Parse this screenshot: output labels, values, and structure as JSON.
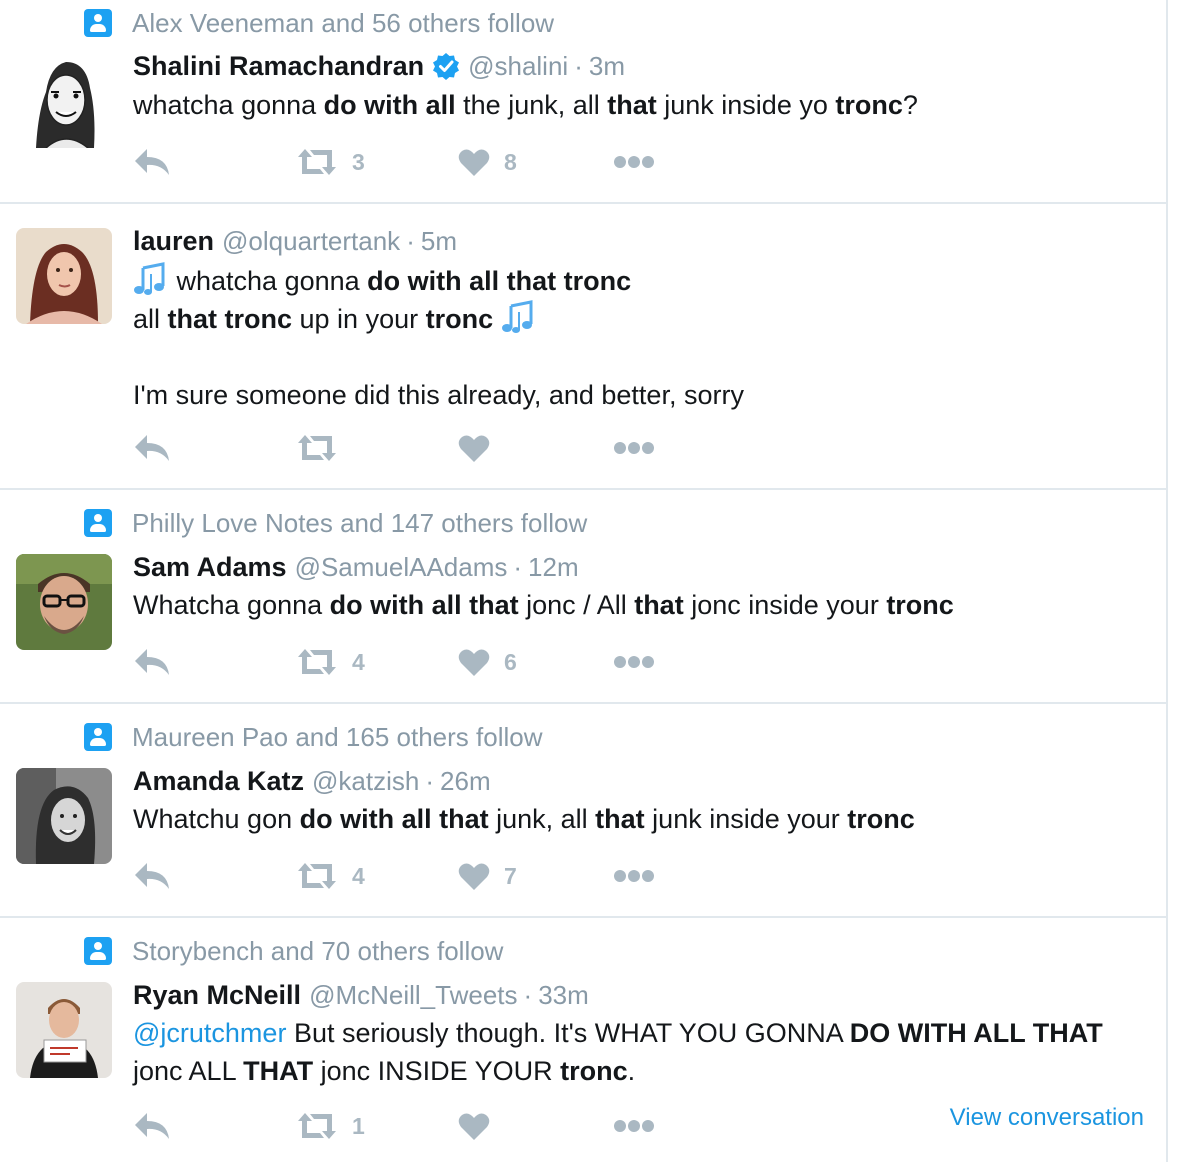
{
  "colors": {
    "accent": "#1da1f2",
    "link": "#1b95e0",
    "muted": "#8899a6",
    "action": "#aab8c2",
    "border": "#e1e8ed"
  },
  "tweets": [
    {
      "context": "Alex Veeneman and 56 others follow",
      "avatar_icon": "sketch-portrait",
      "name": "Shalini Ramachandran",
      "verified": true,
      "handle": "@shalini",
      "sep": "·",
      "time": "3m",
      "lines": [
        [
          "whatcha gonna ",
          {
            "b": "do with all"
          },
          " the junk, all ",
          {
            "b": "that"
          },
          " junk inside yo ",
          {
            "b": "tronc"
          },
          "?"
        ]
      ],
      "retweets": "3",
      "likes": "8"
    },
    {
      "context": "",
      "avatar_icon": "woman-photo",
      "name": "lauren",
      "verified": false,
      "handle": "@olquartertank",
      "sep": "·",
      "time": "5m",
      "lines": [
        [
          {
            "emoji": "music-notes"
          },
          " whatcha gonna ",
          {
            "b": "do with all that tronc"
          }
        ],
        [
          "all ",
          {
            "b": "that tronc"
          },
          " up in your ",
          {
            "b": "tronc"
          },
          " ",
          {
            "emoji": "music-notes"
          }
        ],
        [
          ""
        ],
        [
          "I'm sure someone did this already, and better, sorry"
        ]
      ],
      "retweets": "",
      "likes": ""
    },
    {
      "context": "Philly Love Notes and 147 others follow",
      "avatar_icon": "man-glasses-photo",
      "name": "Sam Adams",
      "verified": false,
      "handle": "@SamuelAAdams",
      "sep": "·",
      "time": "12m",
      "lines": [
        [
          "Whatcha gonna ",
          {
            "b": "do with all that"
          },
          " jonc / All ",
          {
            "b": "that"
          },
          " jonc inside your ",
          {
            "b": "tronc"
          }
        ]
      ],
      "retweets": "4",
      "likes": "6"
    },
    {
      "context": "Maureen Pao and 165 others follow",
      "avatar_icon": "woman-bw-photo",
      "name": "Amanda Katz",
      "verified": false,
      "handle": "@katzish",
      "sep": "·",
      "time": "26m",
      "lines": [
        [
          "Whatchu gon ",
          {
            "b": "do with all that"
          },
          " junk, all ",
          {
            "b": "that"
          },
          " junk inside your ",
          {
            "b": "tronc"
          }
        ]
      ],
      "retweets": "4",
      "likes": "7"
    },
    {
      "context": "Storybench and 70 others follow",
      "avatar_icon": "man-sign-photo",
      "name": "Ryan McNeill",
      "verified": false,
      "handle": "@McNeill_Tweets",
      "sep": "·",
      "time": "33m",
      "lines": [
        [
          {
            "link": "@jcrutchmer"
          },
          " But seriously though. It's WHAT YOU GONNA ",
          {
            "b": "DO WITH ALL THAT"
          }
        ],
        [
          "jonc ALL ",
          {
            "b": "THAT"
          },
          " jonc INSIDE YOUR ",
          {
            "b": "tronc"
          },
          "."
        ]
      ],
      "retweets": "1",
      "likes": "",
      "view_conversation": "View conversation"
    }
  ]
}
